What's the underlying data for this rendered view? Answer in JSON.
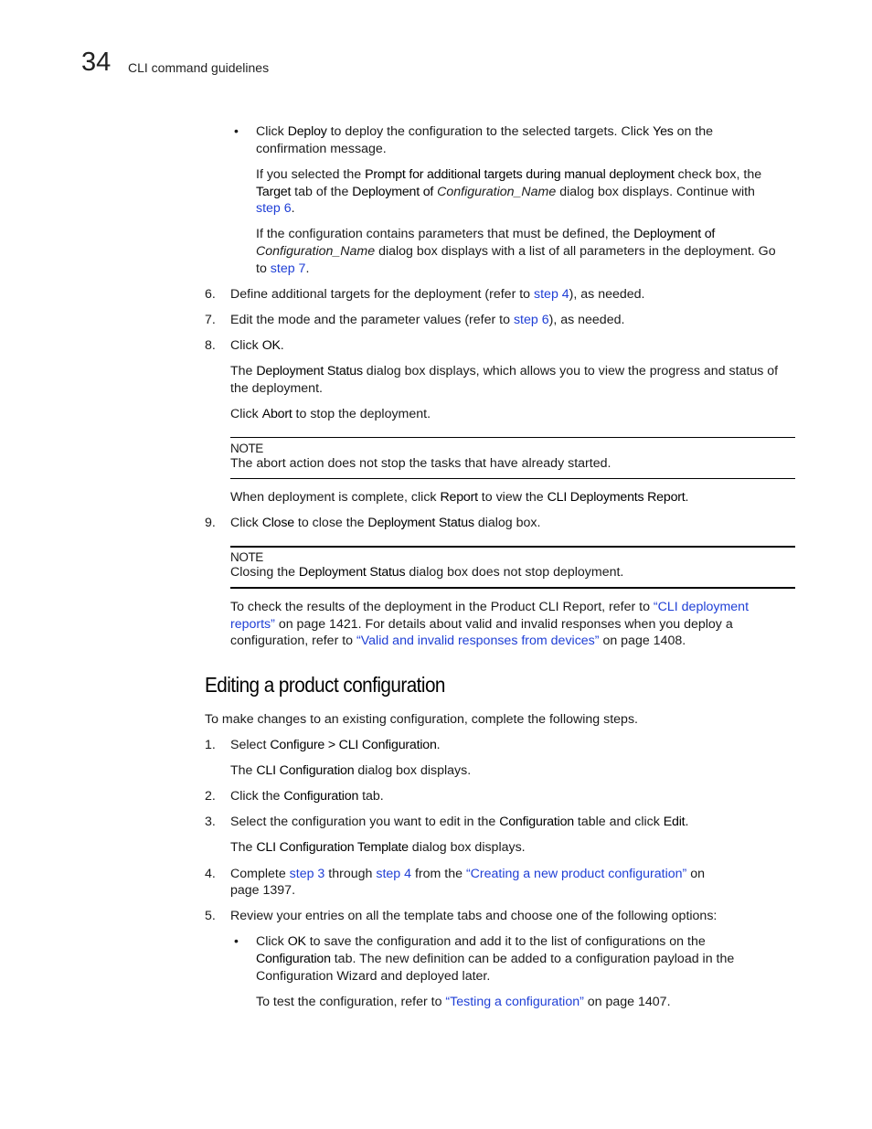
{
  "header": {
    "chapter_number": "34",
    "chapter_title": "CLI command guidelines"
  },
  "top_bullet": {
    "line1": [
      "Click ",
      "Deploy",
      " to deploy the configuration to the selected targets. Click ",
      "Yes",
      " on the"
    ],
    "line2": "confirmation message.",
    "p1_line1": [
      "If you selected the ",
      "Prompt for additional targets during manual deployment",
      " check box, the"
    ],
    "p1_line2": [
      "Target",
      " tab of the ",
      "Deployment of",
      " ",
      "Configuration_Name",
      " dialog box displays. Continue with"
    ],
    "p1_line3": [
      "step 6",
      "."
    ],
    "p2_line1": [
      "If the configuration contains parameters that must be defined, the ",
      "Deployment of"
    ],
    "p2_line2": [
      "Configuration_Name",
      " dialog box displays with a list of all parameters in the deployment. Go"
    ],
    "p2_line3": [
      "to ",
      "step 7",
      "."
    ]
  },
  "steps_a": [
    {
      "num": "6.",
      "parts": [
        "Define additional targets for the deployment (refer to ",
        "step 4",
        "), as needed."
      ]
    },
    {
      "num": "7.",
      "parts": [
        "Edit the mode and the parameter values (refer to ",
        "step 6",
        "), as needed."
      ]
    },
    {
      "num": "8.",
      "parts": [
        "Click ",
        "OK",
        "."
      ]
    }
  ],
  "step8": {
    "p1_line1": [
      "The ",
      "Deployment Status",
      " dialog box displays, which allows you to view the progress and status of"
    ],
    "p1_line2": "the deployment.",
    "p2": [
      "Click ",
      "Abort",
      " to stop the deployment."
    ],
    "note_label": "NOTE",
    "note_text": "The abort action does not stop the tasks that have already started.",
    "p3": [
      "When deployment is complete, click ",
      "Report",
      " to view the ",
      "CLI Deployments Report",
      "."
    ]
  },
  "step9": {
    "num": "9.",
    "parts": [
      "Click ",
      "Close",
      " to close the ",
      "Deployment Status",
      " dialog box."
    ],
    "note_label": "NOTE",
    "note_parts": [
      "Closing the ",
      "Deployment Status",
      " dialog box does not stop deployment."
    ],
    "ref_line1": [
      "To check the results of the deployment in the Product CLI Report, refer to ",
      "“CLI deployment"
    ],
    "ref_line2": [
      "reports”",
      " on page 1421. For details about valid and invalid responses when you deploy a"
    ],
    "ref_line3": [
      "configuration, refer to ",
      "“Valid and invalid responses from devices”",
      " on page 1408."
    ]
  },
  "section": {
    "title": "Editing a product configuration",
    "intro": "To make changes to an existing configuration, complete the following steps.",
    "steps": [
      {
        "num": "1.",
        "parts": [
          "Select ",
          "Configure > CLI Configuration",
          "."
        ],
        "sub": [
          "The ",
          "CLI Configuration",
          " dialog box displays."
        ]
      },
      {
        "num": "2.",
        "parts": [
          "Click the ",
          "Configuration",
          " tab."
        ]
      },
      {
        "num": "3.",
        "parts": [
          "Select the configuration you want to edit in the ",
          "Configuration",
          " table and click ",
          "Edit",
          "."
        ],
        "sub": [
          "The ",
          "CLI Configuration Template",
          " dialog box displays."
        ]
      },
      {
        "num": "4.",
        "parts": [
          "Complete ",
          "step 3",
          " through ",
          "step 4",
          " from the ",
          "“Creating a new product configuration”",
          " on"
        ],
        "line2": "page 1397."
      },
      {
        "num": "5.",
        "parts": [
          "Review your entries on all the template tabs and choose one of the following options:"
        ]
      }
    ],
    "bullet": {
      "line1": [
        "Click ",
        "OK",
        " to save the configuration and add it to the list of configurations on the"
      ],
      "line2": [
        "Configuration",
        " tab. The new definition can be added to a configuration payload in the"
      ],
      "line3": "Configuration Wizard and deployed later.",
      "test_ref": [
        "To test the configuration, refer to ",
        "“Testing a configuration”",
        " on page 1407."
      ]
    }
  },
  "colors": {
    "link": "#1f3fd6",
    "text": "#1a1a1a"
  }
}
